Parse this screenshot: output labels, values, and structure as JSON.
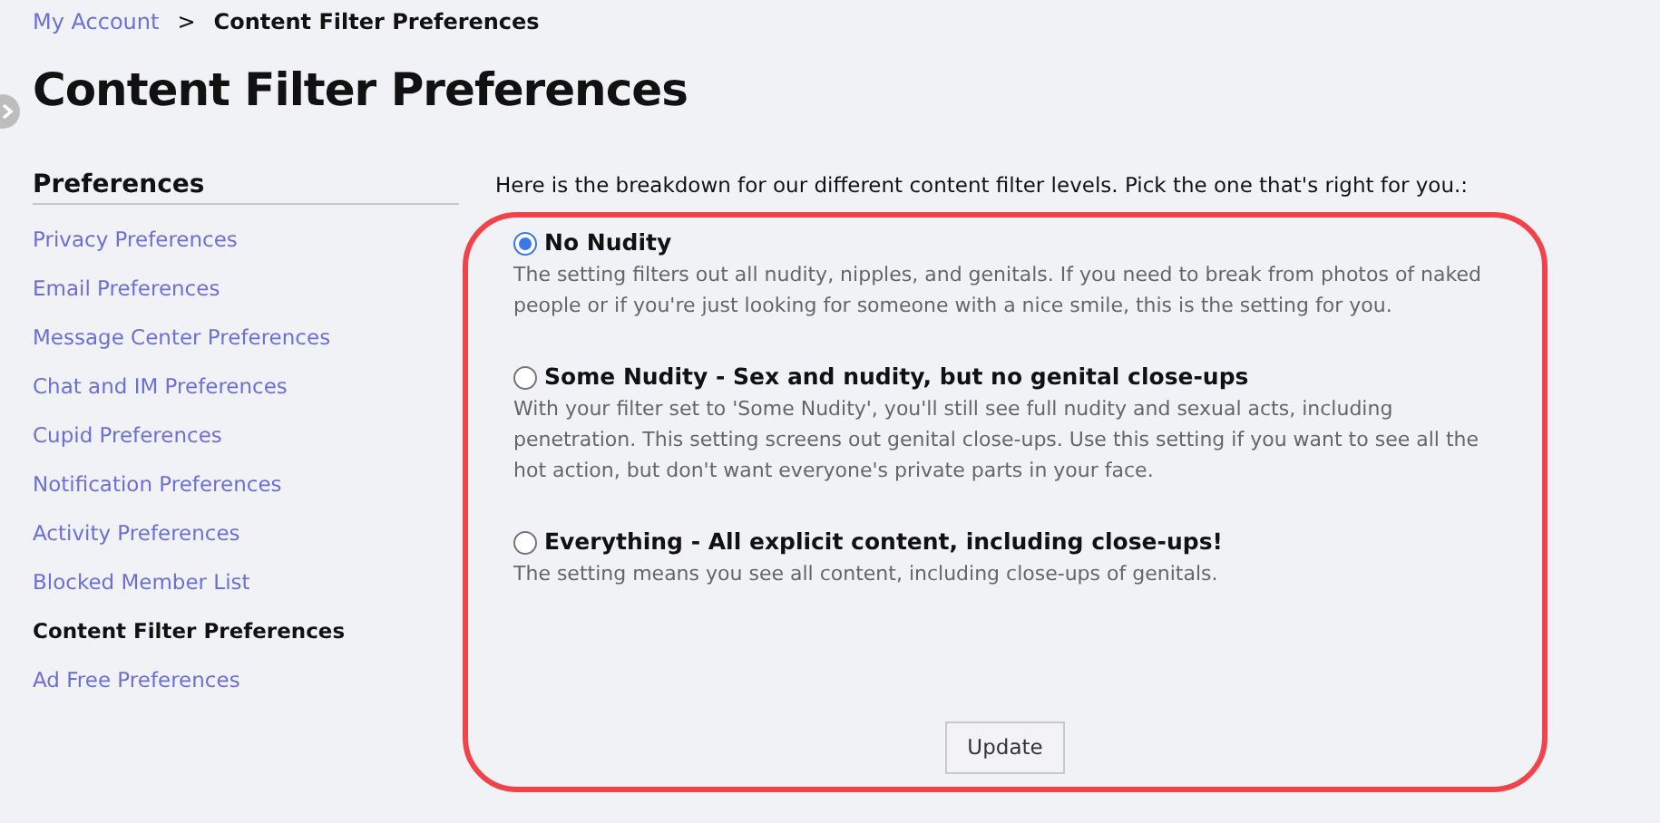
{
  "breadcrumb": {
    "link": "My Account",
    "separator": ">",
    "current": "Content Filter Preferences"
  },
  "title": "Content Filter Preferences",
  "sidebar": {
    "heading": "Preferences",
    "items": [
      {
        "label": "Privacy Preferences",
        "selected": false
      },
      {
        "label": "Email Preferences",
        "selected": false
      },
      {
        "label": "Message Center Preferences",
        "selected": false
      },
      {
        "label": "Chat and IM Preferences",
        "selected": false
      },
      {
        "label": "Cupid Preferences",
        "selected": false
      },
      {
        "label": "Notification Preferences",
        "selected": false
      },
      {
        "label": "Activity Preferences",
        "selected": false
      },
      {
        "label": "Blocked Member List",
        "selected": false
      },
      {
        "label": "Content Filter Preferences",
        "selected": true
      },
      {
        "label": "Ad Free Preferences",
        "selected": false
      }
    ]
  },
  "intro": "Here is the breakdown for our different content filter levels. Pick the one that's right for you.:",
  "options": [
    {
      "label": "No Nudity",
      "description": "The setting filters out all nudity, nipples, and genitals. If you need to break from photos of naked people or if you're just looking for someone with a nice smile, this is the setting for you.",
      "selected": true
    },
    {
      "label": "Some Nudity - Sex and nudity, but no genital close-ups",
      "description": "With your filter set to 'Some Nudity', you'll still see full nudity and sexual acts, including penetration. This setting screens out genital close-ups. Use this setting if you want to see all the hot action, but don't want everyone's private parts in your face.",
      "selected": false
    },
    {
      "label": "Everything - All explicit content, including close-ups!",
      "description": "The setting means you see all content, including close-ups of genitals.",
      "selected": false
    }
  ],
  "update_button": "Update"
}
